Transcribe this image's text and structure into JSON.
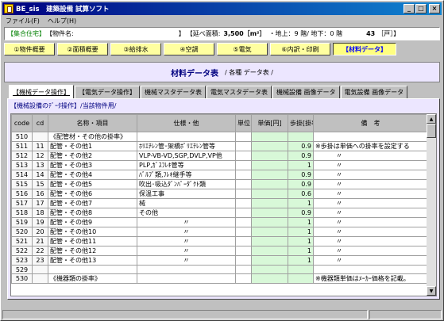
{
  "window": {
    "title": "BE_sis　建築設備 試算ソフト"
  },
  "menu": [
    "ファイル(F)",
    "ヘルプ(H)"
  ],
  "info": {
    "kind": "【集合住宅】",
    "name_label": "【物件名:",
    "name_end": "】",
    "area_label": "【延べ面積:",
    "area_value": "3,500［m²］",
    "floors": "・地上：9 階/ 地下：0 階",
    "units_value": "43",
    "units_label": "［戸］】"
  },
  "nav": [
    "①物件概要",
    "②面積概要",
    "③給排水",
    "④空調",
    "⑤電気",
    "⑥内訳・印刷",
    "【材料データ】"
  ],
  "header": {
    "main": "材料データ表",
    "sub": "/ 各種 データ表 /"
  },
  "tabs": [
    "【機械データ操作】",
    "【電気データ操作】",
    "機械マスタデータ表",
    "電気マスタデータ表",
    "機械設備 画像データ",
    "電気設備 画像データ"
  ],
  "crumb": "【機械設備のﾃﾞｰﾀ操作】/当該物件用/",
  "table": {
    "columns": [
      "code",
      "cd",
      "名称・項目",
      "仕様・他",
      "単位",
      "単価[円]",
      "歩掛[掛率]",
      "備　考"
    ],
    "rows": [
      [
        "510",
        "",
        "《配管材・その他の掛率》",
        "",
        "",
        "",
        "",
        ""
      ],
      [
        "511",
        "11",
        "配管・その他1",
        "ﾎﾘｴﾁﾚﾝ管･架橋ﾎﾟﾘｴﾁﾚﾝ管等",
        "",
        "",
        "0.9",
        "※歩掛は単価への掛率を設定する"
      ],
      [
        "512",
        "12",
        "配管・その他2",
        "VLP-VB-VD,SGP,DVLP,VP他",
        "",
        "",
        "0.9",
        "〃"
      ],
      [
        "513",
        "13",
        "配管・その他3",
        "PLP,ｶﾞｽﾌﾚｷ管等",
        "",
        "",
        "1",
        "〃"
      ],
      [
        "514",
        "14",
        "配管・その他4",
        "ﾊﾞﾙﾌﾞ類,ﾌﾚｷ継手等",
        "",
        "",
        "0.9",
        "〃"
      ],
      [
        "515",
        "15",
        "配管・その他5",
        "吹出･吸込ﾀﾞﾝﾊﾟｰﾀﾞｸﾄ類",
        "",
        "",
        "0.9",
        "〃"
      ],
      [
        "516",
        "16",
        "配管・その他6",
        "保温工事",
        "",
        "",
        "0.6",
        "〃"
      ],
      [
        "517",
        "17",
        "配管・その他7",
        "械",
        "",
        "",
        "1",
        "〃"
      ],
      [
        "518",
        "18",
        "配管・その他8",
        "その他",
        "",
        "",
        "0.9",
        "〃"
      ],
      [
        "519",
        "19",
        "配管・その他9",
        "〃",
        "",
        "",
        "1",
        "〃"
      ],
      [
        "520",
        "20",
        "配管・その他10",
        "〃",
        "",
        "",
        "1",
        "〃"
      ],
      [
        "521",
        "21",
        "配管・その他11",
        "〃",
        "",
        "",
        "1",
        "〃"
      ],
      [
        "522",
        "22",
        "配管・その他12",
        "〃",
        "",
        "",
        "1",
        "〃"
      ],
      [
        "523",
        "23",
        "配管・その他13",
        "〃",
        "",
        "",
        "1",
        "〃"
      ],
      [
        "529",
        "",
        "",
        "",
        "",
        "",
        "",
        ""
      ],
      [
        "530",
        "",
        "《機器類の掛率》",
        "",
        "",
        "",
        "",
        "※機器類単価はﾒｰｶｰ価格を記載。"
      ]
    ]
  }
}
